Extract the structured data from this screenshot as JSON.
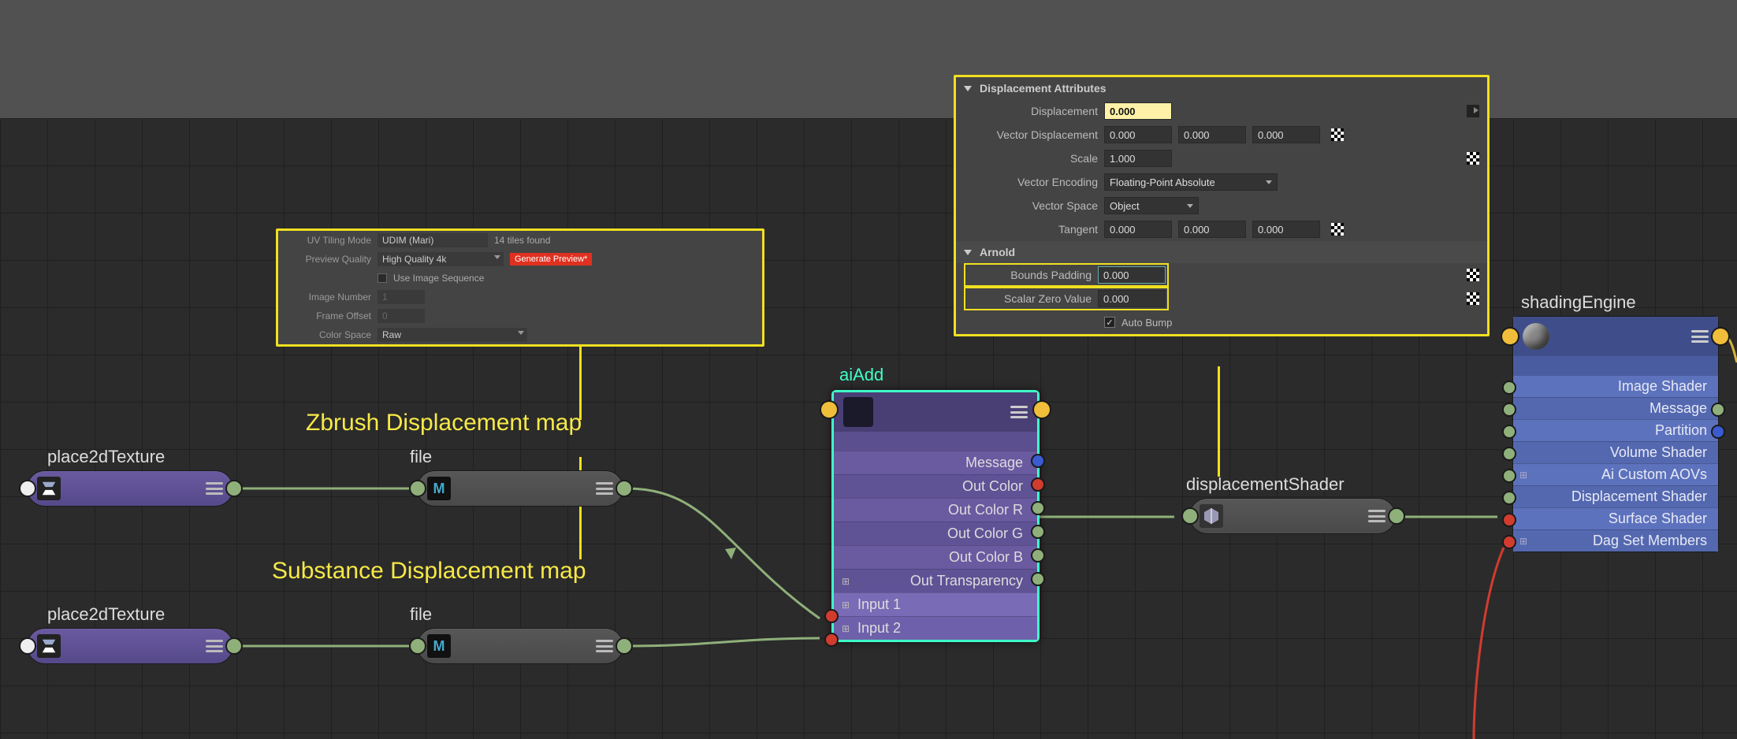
{
  "panel1": {
    "uv_tiling_mode_label": "UV Tiling Mode",
    "uv_tiling_mode_value": "UDIM (Mari)",
    "tiles_found": "14 tiles found",
    "preview_quality_label": "Preview Quality",
    "preview_quality_value": "High Quality 4k",
    "generate_preview": "Generate Preview*",
    "use_image_sequence": "Use Image Sequence",
    "image_number_label": "Image Number",
    "image_number_value": "1",
    "frame_offset_label": "Frame Offset",
    "frame_offset_value": "0",
    "color_space_label": "Color Space",
    "color_space_value": "Raw"
  },
  "panel2": {
    "section1_title": "Displacement Attributes",
    "displacement_label": "Displacement",
    "displacement_value": "0.000",
    "vector_displacement_label": "Vector Displacement",
    "vector_displacement_x": "0.000",
    "vector_displacement_y": "0.000",
    "vector_displacement_z": "0.000",
    "scale_label": "Scale",
    "scale_value": "1.000",
    "vector_encoding_label": "Vector Encoding",
    "vector_encoding_value": "Floating-Point Absolute",
    "vector_space_label": "Vector Space",
    "vector_space_value": "Object",
    "tangent_label": "Tangent",
    "tangent_x": "0.000",
    "tangent_y": "0.000",
    "tangent_z": "0.000",
    "section2_title": "Arnold",
    "bounds_padding_label": "Bounds Padding",
    "bounds_padding_value": "0.000",
    "scalar_zero_label": "Scalar Zero Value",
    "scalar_zero_value": "0.000",
    "auto_bump_label": "Auto Bump",
    "auto_bump_checked": true
  },
  "annotations": {
    "zbrush": "Zbrush Displacement map",
    "substance": "Substance Displacement map"
  },
  "nodes": {
    "place2d_1_title": "place2dTexture",
    "place2d_2_title": "place2dTexture",
    "file_1_title": "file",
    "file_2_title": "file",
    "file_icon": "M",
    "aiadd_title": "aiAdd",
    "aiadd": {
      "message": "Message",
      "out_color": "Out Color",
      "out_color_r": "Out Color R",
      "out_color_g": "Out Color G",
      "out_color_b": "Out Color B",
      "out_transparency": "Out Transparency",
      "input1": "Input 1",
      "input2": "Input 2"
    },
    "disp_shader_title": "displacementShader",
    "se_title": "shadingEngine",
    "se": {
      "image_shader": "Image Shader",
      "message": "Message",
      "partition": "Partition",
      "volume_shader": "Volume Shader",
      "ai_custom_aovs": "Ai Custom AOVs",
      "displacement_shader": "Displacement Shader",
      "surface_shader": "Surface Shader",
      "dag_set_members": "Dag Set Members"
    }
  }
}
